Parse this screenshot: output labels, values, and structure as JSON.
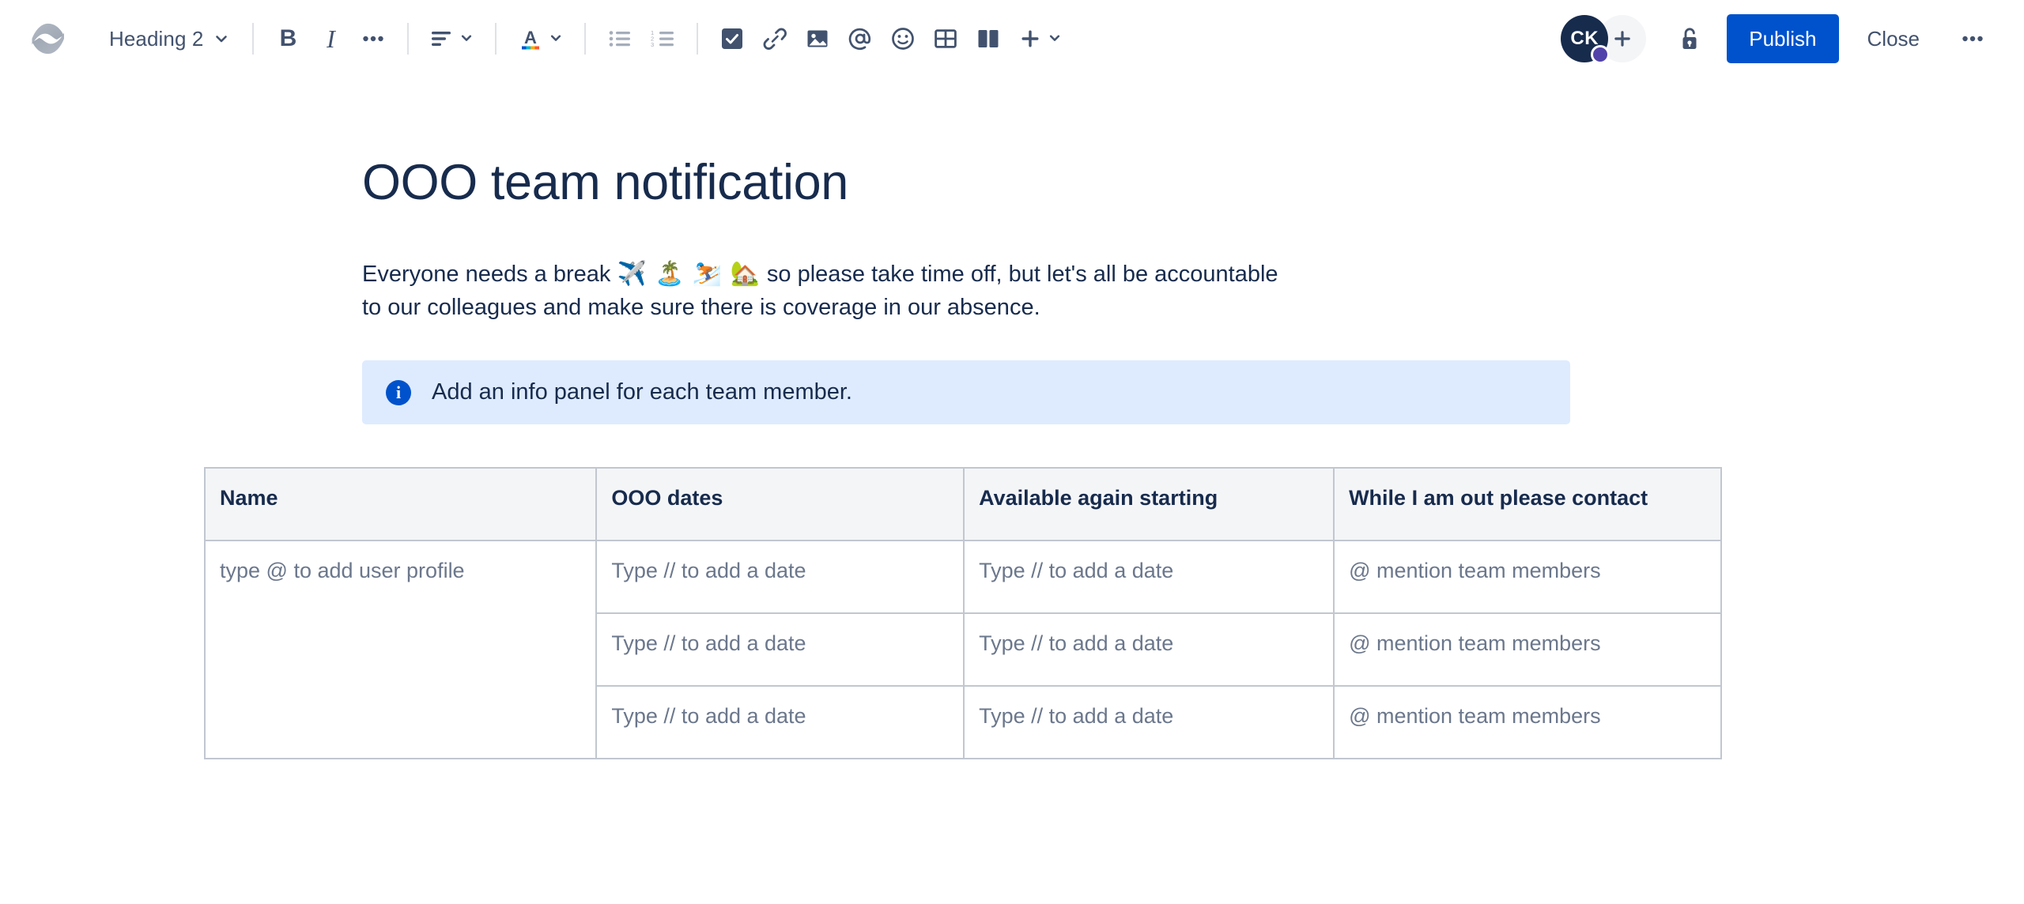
{
  "toolbar": {
    "logo_name": "confluence-logo",
    "block_type": {
      "label": "Heading 2",
      "chevron": "chevron-down-icon"
    },
    "bold_label": "B",
    "italic_label": "I",
    "more_formatting_label": "•••",
    "align_icon": "text-align-icon",
    "text_color_icon": "text-color-icon",
    "text_color_letter": "A",
    "bullet_list_icon": "bullet-list-icon",
    "numbered_list_icon": "numbered-list-icon",
    "task_icon": "task-checkbox-icon",
    "link_icon": "link-icon",
    "image_icon": "image-icon",
    "mention_icon": "mention-at-icon",
    "emoji_icon": "emoji-smiley-icon",
    "table_icon": "table-icon",
    "layout_icon": "two-column-layout-icon",
    "insert_icon": "plus-icon"
  },
  "header": {
    "avatar_initials": "CK",
    "avatar_badge": "●",
    "add_person_icon": "plus-icon",
    "restrictions_icon": "unlock-padlock-icon",
    "publish_label": "Publish",
    "close_label": "Close",
    "more_actions_label": "•••",
    "publish_color": "#0052CC",
    "avatar_color": "#172B4D",
    "avatar_badge_color": "#5243AA"
  },
  "document": {
    "title": "OOO team notification",
    "paragraph_part1": "Everyone needs a break ",
    "paragraph_emojis": "✈️ 🏝️ ⛷️ 🏡",
    "paragraph_part2": " so please take time off, but let's all be accountable to our colleagues and make sure there is coverage in our absence.",
    "info_panel": {
      "icon": "info-circle-icon",
      "icon_glyph": "i",
      "text": "Add an info panel for each team member.",
      "background": "#DEEBFF"
    },
    "table": {
      "headers": [
        "Name",
        "OOO dates",
        "Available again starting",
        "While I am out please contact"
      ],
      "name_cell": "type @ to add user profile",
      "rows": [
        {
          "ooo_dates": "Type // to add a date",
          "available": "Type // to add a date",
          "contact": "@ mention team members"
        },
        {
          "ooo_dates": "Type // to add a date",
          "available": "Type // to add a date",
          "contact": "@ mention team members"
        },
        {
          "ooo_dates": "Type // to add a date",
          "available": "Type // to add a date",
          "contact": "@ mention team members"
        }
      ]
    }
  }
}
